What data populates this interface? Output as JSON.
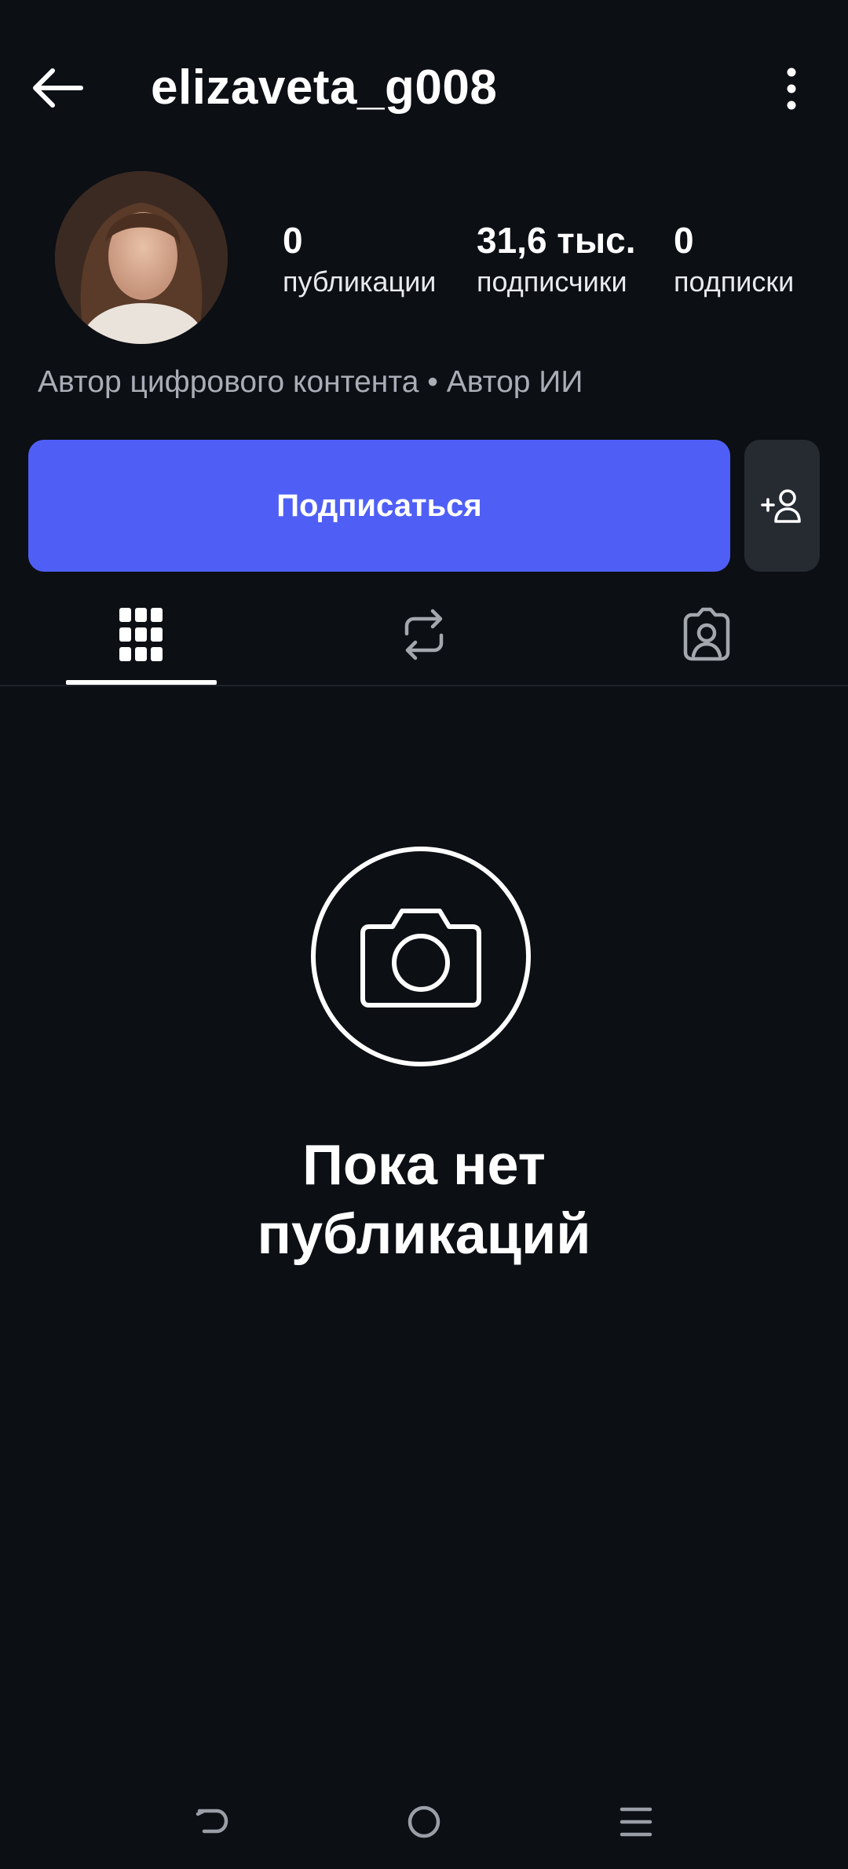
{
  "header": {
    "username": "elizaveta_g008",
    "back_icon": "arrow-left-icon",
    "more_icon": "more-vertical-icon"
  },
  "profile": {
    "avatar_icon": "profile-photo",
    "stats": {
      "posts": {
        "value": "0",
        "label": "публикации"
      },
      "followers": {
        "value": "31,6 тыс.",
        "label": "подписчики"
      },
      "following": {
        "value": "0",
        "label": "подписки"
      }
    },
    "bio": "Автор цифрового контента • Автор ИИ"
  },
  "actions": {
    "follow_label": "Подписаться",
    "follow_color": "#4f5ff6",
    "add_user_icon": "add-user-icon"
  },
  "tabs": [
    {
      "icon": "grid-icon",
      "active": true
    },
    {
      "icon": "repost-icon",
      "active": false
    },
    {
      "icon": "tagged-person-icon",
      "active": false
    }
  ],
  "empty_state": {
    "icon": "camera-icon",
    "line1": "Пока нет",
    "line2": "публикаций"
  },
  "system_nav": {
    "back_icon": "nav-back-icon",
    "home_icon": "nav-home-icon",
    "recents_icon": "nav-recents-icon"
  },
  "colors": {
    "background": "#0c0f14",
    "secondary_button": "#262a31",
    "muted_text": "#a9adb6"
  }
}
